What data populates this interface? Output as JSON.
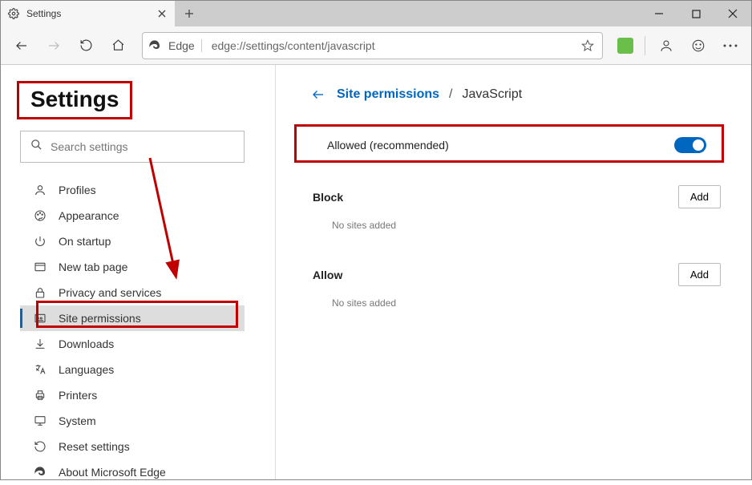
{
  "tab": {
    "title": "Settings"
  },
  "address": {
    "edge_label": "Edge",
    "url": "edge://settings/content/javascript"
  },
  "search": {
    "placeholder": "Search settings"
  },
  "settings_heading": "Settings",
  "nav": {
    "profiles": "Profiles",
    "appearance": "Appearance",
    "onstartup": "On startup",
    "newtab": "New tab page",
    "privacy": "Privacy and services",
    "siteperm": "Site permissions",
    "downloads": "Downloads",
    "languages": "Languages",
    "printers": "Printers",
    "system": "System",
    "reset": "Reset settings",
    "about": "About Microsoft Edge"
  },
  "breadcrumb": {
    "parent": "Site permissions",
    "separator": "/",
    "current": "JavaScript"
  },
  "toggle": {
    "label": "Allowed (recommended)",
    "on": true
  },
  "block": {
    "label": "Block",
    "add": "Add",
    "empty": "No sites added"
  },
  "allow": {
    "label": "Allow",
    "add": "Add",
    "empty": "No sites added"
  }
}
